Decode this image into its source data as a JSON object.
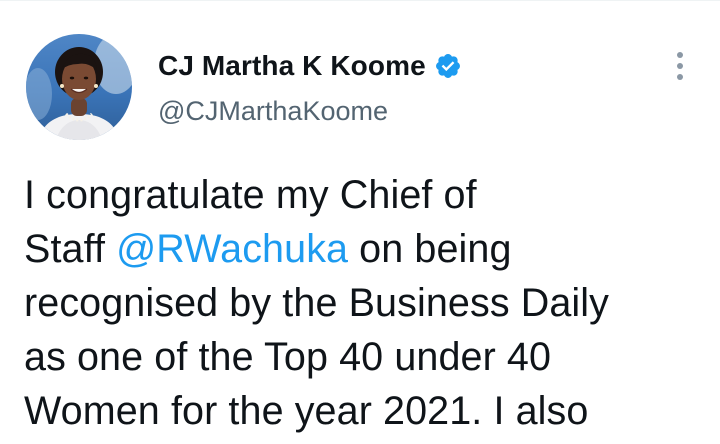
{
  "author": {
    "display_name": "CJ Martha K Koome",
    "handle": "@CJMarthaKoome",
    "verified": true,
    "verified_icon": "verified-badge-icon",
    "avatar_icon": "profile-photo"
  },
  "menu": {
    "icon": "more-options-icon"
  },
  "tweet": {
    "line1": "I congratulate my Chief of",
    "line2_pre": "Staff ",
    "mention": "@RWachuka",
    "line2_post": " on being",
    "line3": "recognised by the Business Daily",
    "line4": "as one of the Top 40 under 40",
    "line5": "Women for the year 2021. I also"
  },
  "colors": {
    "text": "#0f1419",
    "secondary_text": "#536471",
    "link": "#1d9bf0",
    "verified": "#1d9bf0"
  }
}
